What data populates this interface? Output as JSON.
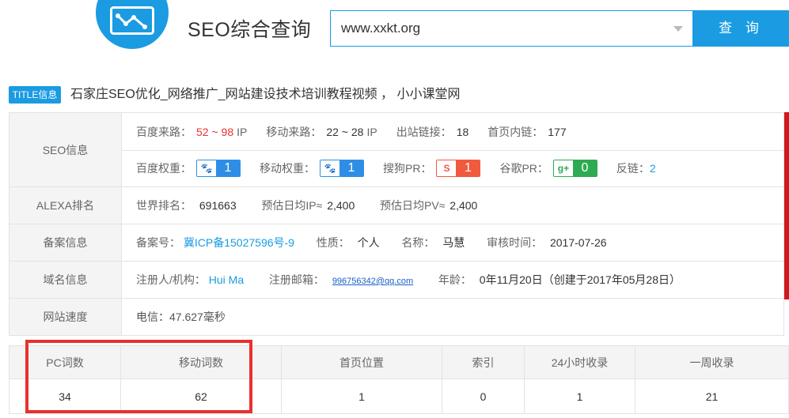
{
  "header": {
    "site_title": "SEO综合查询",
    "search_value": "www.xxkt.org",
    "search_button": "查 询"
  },
  "title_info": {
    "tag": "TITLE信息",
    "text": "石家庄SEO优化_网络推广_网站建设技术培训教程视频 ， 小小课堂网"
  },
  "seo": {
    "label": "SEO信息",
    "baidu_traffic_label": "百度来路：",
    "baidu_traffic_value": "52 ~ 98",
    "baidu_traffic_unit": "IP",
    "mobile_traffic_label": "移动来路：",
    "mobile_traffic_value": "22 ~ 28",
    "mobile_traffic_unit": "IP",
    "outbound_links_label": "出站链接：",
    "outbound_links_value": "18",
    "home_internal_links_label": "首页内链：",
    "home_internal_links_value": "177",
    "baidu_weight_label": "百度权重：",
    "baidu_weight_value": "1",
    "mobile_weight_label": "移动权重：",
    "mobile_weight_value": "1",
    "sogou_pr_label": "搜狗PR：",
    "sogou_pr_value": "1",
    "google_pr_label": "谷歌PR：",
    "google_pr_value": "0",
    "backlinks_label": "反链：",
    "backlinks_value": "2",
    "baidu_icon": "baidu-paw-icon",
    "mobile_icon": "baidu-paw-icon",
    "sogou_icon": "sogou-icon",
    "google_icon": "google-plus-icon"
  },
  "alexa": {
    "label": "ALEXA排名",
    "world_rank_label": "世界排名：",
    "world_rank_value": "691663",
    "daily_ip_label": "预估日均IP≈",
    "daily_ip_value": "2,400",
    "daily_pv_label": "预估日均PV≈",
    "daily_pv_value": "2,400"
  },
  "icp": {
    "label": "备案信息",
    "number_label": "备案号：",
    "number_value": "冀ICP备15027596号-9",
    "nature_label": "性质：",
    "nature_value": "个人",
    "name_label": "名称：",
    "name_value": "马慧",
    "review_label": "审核时间：",
    "review_value": "2017-07-26"
  },
  "domain": {
    "label": "域名信息",
    "registrant_label": "注册人/机构：",
    "registrant_value": "Hui Ma",
    "email_label": "注册邮箱：",
    "email_value": "996756342@qq.com",
    "age_label": "年龄：",
    "age_value": "0年11月20日（创建于2017年05月28日）"
  },
  "speed": {
    "label": "网站速度",
    "value": "电信：47.627毫秒"
  },
  "stats": {
    "headers": [
      "PC词数",
      "移动词数",
      "首页位置",
      "索引",
      "24小时收录",
      "一周收录"
    ],
    "values": [
      "34",
      "62",
      "1",
      "0",
      "1",
      "21"
    ]
  },
  "colors": {
    "accent": "#1a9be2",
    "highlight_red": "#e8312f"
  }
}
